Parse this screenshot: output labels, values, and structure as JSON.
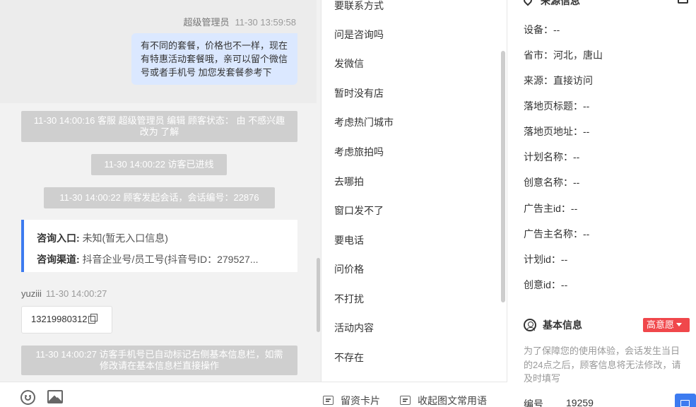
{
  "chat": {
    "agent_name": "超级管理员",
    "agent_time": "11-30 13:59:58",
    "agent_message": "有不同的套餐，价格也不一样，现在有特惠活动套餐哦，亲可以留个微信号或者手机号 加您发套餐参考下",
    "system_1": "11-30 14:00:16 客服 超级管理员 编辑 顾客状态： 由 不感兴趣 改为 了解",
    "system_2": "11-30 14:00:22 访客已进线",
    "system_3": "11-30 14:00:22 顾客发起会话，会话编号：22876",
    "card": {
      "entry_label": "咨询入口:",
      "entry_value": "未知(暂无入口信息)",
      "channel_label": "咨询渠道:",
      "channel_value": "抖音企业号/员工号(抖音号ID：279527..."
    },
    "visitor_name": "yuziii",
    "visitor_time": "11-30 14:00:27",
    "visitor_message": "13219980312",
    "system_4": "11-30 14:00:27 访客手机号已自动标记右侧基本信息栏，如需修改请在基本信息栏直接操作"
  },
  "toolbar": {
    "icons": [
      "emoji-icon",
      "image-icon"
    ],
    "lead_card": "留资卡片",
    "collapse_phrases": "收起图文常用语"
  },
  "quick_replies": [
    "要联系方式",
    "问是咨询吗",
    "发微信",
    "暂时没有店",
    "考虑热门城市",
    "考虑旅拍吗",
    "去哪拍",
    "窗口发不了",
    "要电话",
    "问价格",
    "不打扰",
    "活动内容",
    "不存在"
  ],
  "info": {
    "source_title": "来源信息",
    "rows": [
      {
        "label": "设备：",
        "value": "--"
      },
      {
        "label": "省市：",
        "value": "河北，唐山"
      },
      {
        "label": "来源：",
        "value": "直接访问"
      },
      {
        "label": "落地页标题：",
        "value": "--"
      },
      {
        "label": "落地页地址：",
        "value": "--"
      },
      {
        "label": "计划名称：",
        "value": "--"
      },
      {
        "label": "创意名称：",
        "value": "--"
      },
      {
        "label": "广告主id：",
        "value": "--"
      },
      {
        "label": "广告主名称：",
        "value": "--"
      },
      {
        "label": "计划id：",
        "value": "--"
      },
      {
        "label": "创意id：",
        "value": "--"
      }
    ],
    "basic_title": "基本信息",
    "intent_badge": "高意愿",
    "notice": "为了保障您的使用体验，会话发生当日的24点之后，顾客信息将无法修改，请及时填写",
    "number_label": "编号",
    "number_value": "19259"
  },
  "colors": {
    "accent": "#3d7bf0",
    "badge": "#f0474b",
    "agent_bubble": "#dbe8ff",
    "system_pill": "#cfcfcf"
  }
}
